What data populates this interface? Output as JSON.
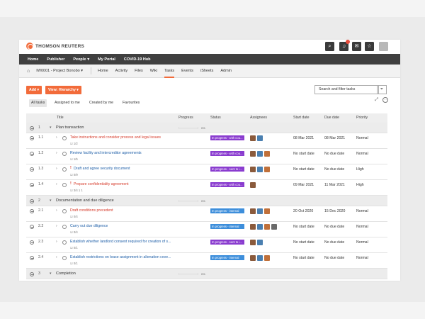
{
  "header": {
    "logo": "THOMSON REUTERS",
    "notification_count": ""
  },
  "topnav": [
    "Home",
    "Publisher",
    "People",
    "My Portal",
    "COVID-19 Hub"
  ],
  "subnav": {
    "project": "IW0001 - Project Bonobo",
    "tabs": [
      "Home",
      "Activity",
      "Files",
      "Wiki",
      "Tasks",
      "Events",
      "iSheets",
      "Admin"
    ],
    "active_tab": "Tasks"
  },
  "toolbar": {
    "add": "Add",
    "view": "View: Hierarchy",
    "search_placeholder": "Search and filter tasks"
  },
  "filters": [
    "All tasks",
    "Assigned to me",
    "Created by me",
    "Favourites"
  ],
  "columns": [
    "Title",
    "Progress",
    "Status",
    "Assignees",
    "Start date",
    "Due date",
    "Priority"
  ],
  "colors": {
    "accent": "#f26b3a",
    "in_progress_internal": "#3d8edb",
    "in_progress_sent": "#8a3ccf",
    "red_title": "#d63b2b",
    "blue_title": "#1f5fa8"
  },
  "rows": [
    {
      "kind": "group",
      "num": "1",
      "title": "Plan transaction",
      "progress_pct": "0%"
    },
    {
      "kind": "task",
      "num": "1.1",
      "title": "Take instructions and consider process and legal issues",
      "title_color": "red",
      "meta": "1/2",
      "status": "In progress - with cou...",
      "status_type": "sent",
      "assignees": 2,
      "start": "08 Mar 2021",
      "due": "08 Mar 2021",
      "priority": "Normal"
    },
    {
      "kind": "task",
      "num": "1.2",
      "title": "Review facility and intercreditor agreements",
      "title_color": "blue",
      "meta": "1/5",
      "status": "In progress - with cou...",
      "status_type": "sent",
      "assignees": 3,
      "start": "No start date",
      "due": "No due date",
      "priority": "Normal"
    },
    {
      "kind": "task",
      "num": "1.3",
      "title": "Draft and agree security document",
      "title_color": "blue",
      "flag": "!",
      "meta": "0/9",
      "status": "In progress - sent to i...",
      "status_type": "sent",
      "assignees": 3,
      "start": "No start date",
      "due": "No due date",
      "priority": "High"
    },
    {
      "kind": "task",
      "num": "1.4",
      "title": "Prepare confidentiality agreement",
      "title_color": "red",
      "flag": "!",
      "meta": "3/4   1   1",
      "status": "In progress - with cou...",
      "status_type": "sent",
      "assignees": 1,
      "start": "09 Mar 2021",
      "due": "11 Mar 2021",
      "priority": "High"
    },
    {
      "kind": "group",
      "num": "2",
      "title": "Documentation and due diligence",
      "progress_pct": "0%"
    },
    {
      "kind": "task",
      "num": "2.1",
      "title": "Draft conditions precedent",
      "title_color": "red",
      "meta": "0/4",
      "status": "In progress - internal",
      "status_type": "internal",
      "assignees": 3,
      "start": "20 Oct 2020",
      "due": "15 Dec 2020",
      "priority": "Normal"
    },
    {
      "kind": "task",
      "num": "2.2",
      "title": "Carry out due diligence",
      "title_color": "blue",
      "meta": "0/4",
      "status": "In progress - internal",
      "status_type": "internal",
      "assignees": 4,
      "start": "No start date",
      "due": "No due date",
      "priority": "Normal"
    },
    {
      "kind": "task",
      "num": "2.3",
      "title": "Establish whether landlord consent required for creation of s...",
      "title_color": "blue",
      "meta": "0/1",
      "status": "In progress - sent to i...",
      "status_type": "sent",
      "assignees": 2,
      "start": "No start date",
      "due": "No due date",
      "priority": "Normal"
    },
    {
      "kind": "task",
      "num": "2.4",
      "title": "Establish restrictions on lease assignment in alienation cove...",
      "title_color": "blue",
      "meta": "0/1",
      "status": "In progress - internal",
      "status_type": "internal",
      "assignees": 3,
      "start": "No start date",
      "due": "No due date",
      "priority": "Normal"
    },
    {
      "kind": "group",
      "num": "3",
      "title": "Completion",
      "progress_pct": "0%"
    }
  ]
}
